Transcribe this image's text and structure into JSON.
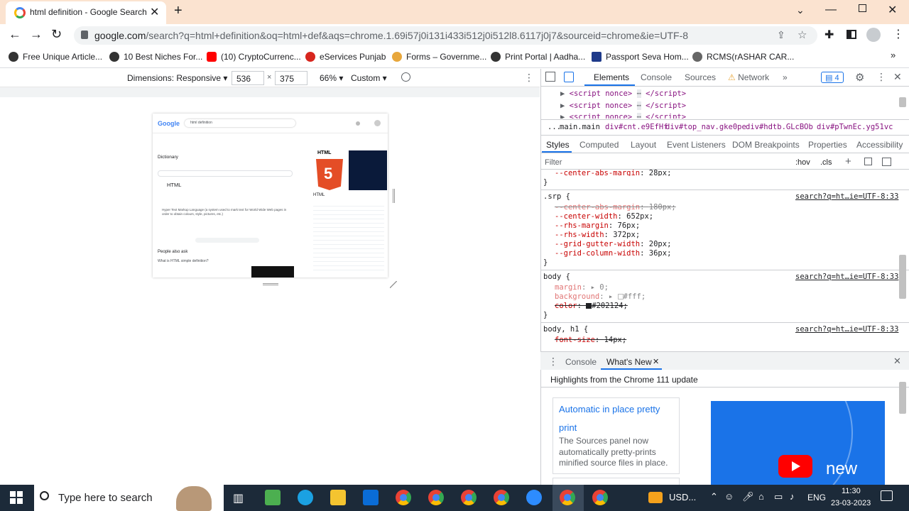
{
  "tab": {
    "title": "html definition - Google Search"
  },
  "address": {
    "url_host": "google.com",
    "url_rest": "/search?q=html+definition&oq=html+def&aqs=chrome.1.69i57j0i131i433i512j0i512l8.6117j0j7&sourceid=chrome&ie=UTF-8"
  },
  "bookmarks": [
    {
      "label": "Free Unique Article...",
      "color": "#333333"
    },
    {
      "label": "10 Best Niches For...",
      "color": "#333333"
    },
    {
      "label": "(10) CryptoCurrenc...",
      "color": "#ff0000"
    },
    {
      "label": "eServices Punjab",
      "color": "#d7261e"
    },
    {
      "label": "Forms – Governme...",
      "color": "#e8a73c"
    },
    {
      "label": "Print Portal | Aadha...",
      "color": "#333333"
    },
    {
      "label": "Passport Seva Hom...",
      "color": "#1e3a8a"
    },
    {
      "label": "RCMS(rASHAR CAR...",
      "color": "#666666"
    }
  ],
  "device_toolbar": {
    "dimensions_label": "Dimensions: Responsive",
    "width": "536",
    "height": "375",
    "times": "×",
    "zoom": "66%",
    "throttle": "Custom"
  },
  "preview": {
    "logo": "Google",
    "query": "html definition",
    "dictionary": "Dictionary",
    "word": "HTML",
    "definition": "Hyper Text Markup Language (a system used to mark text for World Wide Web pages in order to obtain colours, style, pictures, etc.)",
    "people_also_ask": "People also ask",
    "paa_item": "What is HTML simple definition?",
    "kp_title": "HTML",
    "kp_caption": "HTML"
  },
  "devtools": {
    "tabs": [
      "Elements",
      "Console",
      "Sources",
      "Network"
    ],
    "more": "»",
    "issues": "4",
    "elements_lines": [
      "<script nonce>",
      "<script nonce>",
      "<script nonce>"
    ],
    "breadcrumbs": [
      "...",
      "main.main",
      "div#cnt.e9EfHf",
      "div#top_nav.gke0pe",
      "div#hdtb.GLcBOb",
      "div#pTwnEc.yg51vc"
    ],
    "style_tabs": [
      "Styles",
      "Computed",
      "Layout",
      "Event Listeners",
      "DOM Breakpoints",
      "Properties",
      "Accessibility"
    ],
    "filter_placeholder": "Filter",
    "hov": ":hov",
    "cls": ".cls",
    "rules": {
      "top_prop": "--center-abs-margin",
      "top_val": "28px",
      "srp_selector": ".srp {",
      "srp_source": "search?q=ht…ie=UTF-8:33",
      "srp_props": [
        {
          "name": "--center-abs-margin",
          "value": "180px",
          "struck": true
        },
        {
          "name": "--center-width",
          "value": "652px",
          "struck": false
        },
        {
          "name": "--rhs-margin",
          "value": "76px",
          "struck": false
        },
        {
          "name": "--rhs-width",
          "value": "372px",
          "struck": false
        },
        {
          "name": "--grid-gutter-width",
          "value": "20px",
          "struck": false
        },
        {
          "name": "--grid-column-width",
          "value": "36px",
          "struck": false
        }
      ],
      "body_selector": "body {",
      "body_source": "search?q=ht…ie=UTF-8:33",
      "body_props": [
        {
          "name": "margin",
          "value": "0",
          "struck": false
        },
        {
          "name": "background",
          "value": "#fff",
          "struck": false
        },
        {
          "name": "color",
          "value": "#202124",
          "struck": true
        }
      ],
      "bodyh1_selector": "body, h1 {",
      "bodyh1_source": "search?q=ht…ie=UTF-8:33",
      "bodyh1_prop": {
        "name": "font-size",
        "value": "14px",
        "struck": true
      }
    },
    "drawer": {
      "tabs": [
        "Console",
        "What's New"
      ],
      "highlight": "Highlights from the Chrome 111 update",
      "card_title": "Automatic in place pretty print",
      "card_body": "The Sources panel now automatically pretty-prints minified source files in place.",
      "video_text": "new"
    }
  },
  "taskbar": {
    "search_placeholder": "Type here to search",
    "weather": "USD...",
    "language": "ENG",
    "time": "11:30",
    "date": "23-03-2023"
  },
  "colors": {
    "accent": "#1a73e8",
    "tabstrip": "#fbe3d0",
    "taskbar": "#1c2a39"
  }
}
